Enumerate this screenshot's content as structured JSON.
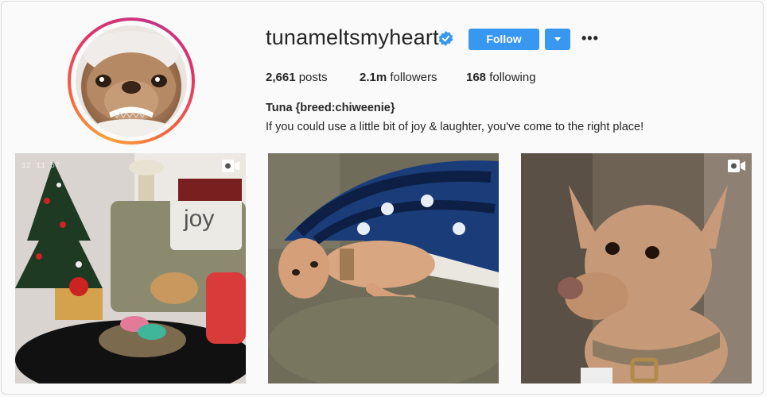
{
  "profile": {
    "username": "tunameltsmyheart",
    "verified_icon": "verified-badge-icon",
    "follow_label": "Follow",
    "more_label": "•••",
    "stats": {
      "posts_count": "2,661",
      "posts_label": "posts",
      "followers_count": "2.1m",
      "followers_label": "followers",
      "following_count": "168",
      "following_label": "following"
    },
    "bio_name": "Tuna {breed:chiweenie}",
    "bio_text": "If you could use a little bit of joy & laughter, you've come to the right place!"
  },
  "posts": [
    {
      "type": "video",
      "icon": "video-camera-icon",
      "pillow_text": "joy",
      "timestamp": "12 11 57"
    },
    {
      "type": "image"
    },
    {
      "type": "video",
      "icon": "video-camera-icon"
    }
  ],
  "colors": {
    "accent": "#3897f0",
    "text": "#262626",
    "background": "#fafafa"
  }
}
